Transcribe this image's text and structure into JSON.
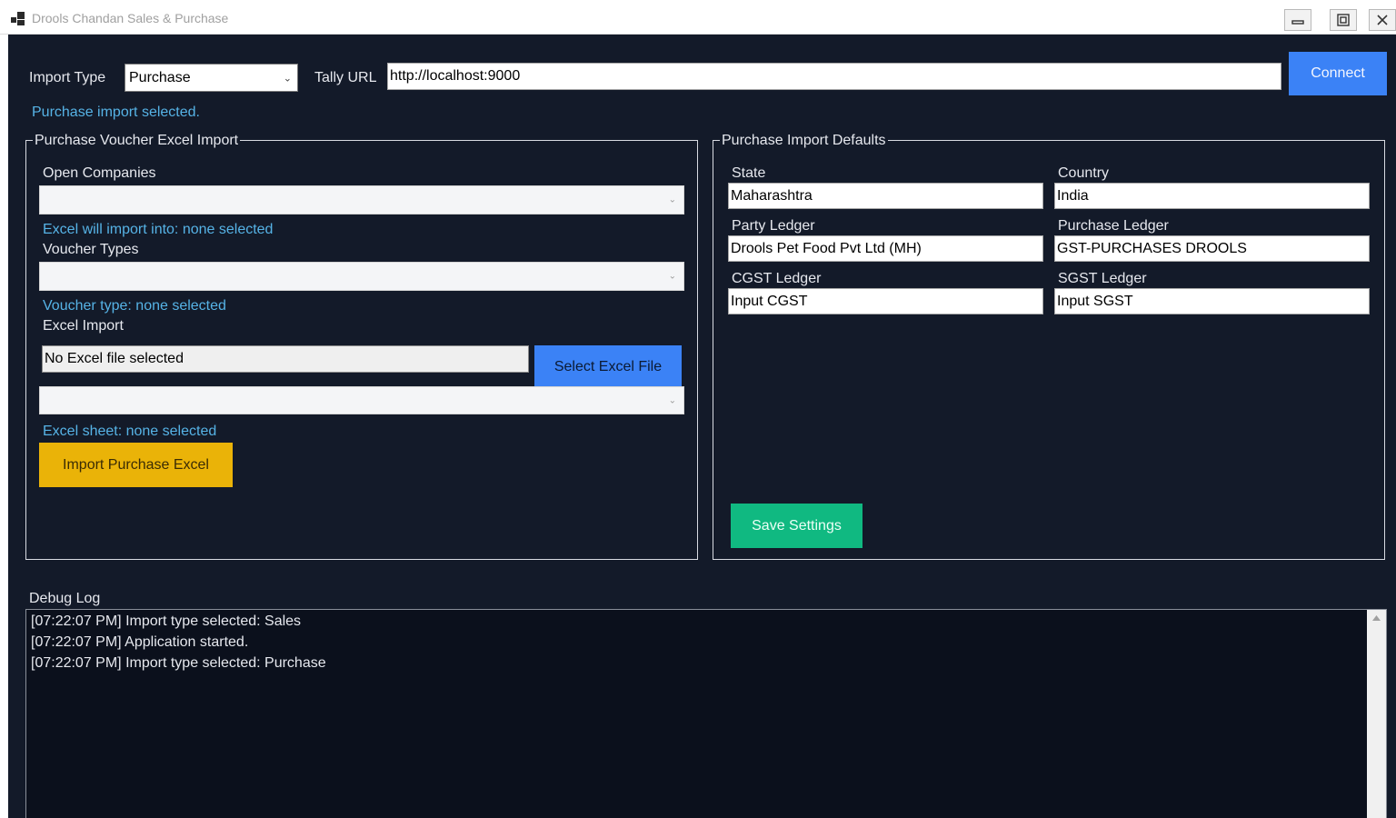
{
  "window": {
    "title": "Drools Chandan Sales & Purchase"
  },
  "topbar": {
    "import_type_label": "Import Type",
    "import_type_value": "Purchase",
    "tally_url_label": "Tally URL",
    "tally_url_value": "http://localhost:9000",
    "connect_label": "Connect",
    "status_text": "Purchase import selected."
  },
  "voucher_group": {
    "title": "Purchase Voucher  Excel Import",
    "open_companies_label": "Open Companies",
    "companies_info": "Excel will import into: none selected",
    "voucher_types_label": "Voucher Types",
    "voucher_info": "Voucher type: none selected",
    "excel_import_label": "Excel Import",
    "file_value": "No Excel file selected",
    "select_file_label": "Select Excel File",
    "sheet_info": "Excel sheet: none selected",
    "import_button_label": "Import Purchase Excel"
  },
  "defaults_group": {
    "title": "Purchase Import Defaults",
    "fields": [
      {
        "label": "State",
        "value": "Maharashtra"
      },
      {
        "label": "Country",
        "value": "India"
      },
      {
        "label": "Party Ledger",
        "value": "Drools Pet Food Pvt Ltd (MH)"
      },
      {
        "label": "Purchase Ledger",
        "value": "GST-PURCHASES DROOLS"
      },
      {
        "label": "CGST Ledger",
        "value": "Input CGST"
      },
      {
        "label": "SGST Ledger",
        "value": "Input SGST"
      }
    ],
    "save_label": "Save Settings"
  },
  "debug": {
    "label": "Debug Log",
    "lines": [
      "[07:22:07 PM] Import type selected: Sales",
      "[07:22:07 PM] Application started.",
      "[07:22:07 PM] Import type selected: Purchase"
    ]
  },
  "colors": {
    "background": "#131a29",
    "info_text": "#56b3e6",
    "connect_button": "#3b82f6",
    "import_button": "#eab308",
    "save_button": "#10b981"
  },
  "icons": {
    "app": "app-grid-icon",
    "minimize": "minimize-icon",
    "maximize": "restore-icon",
    "close": "close-icon",
    "dropdown": "chevron-down-icon",
    "scroll_up": "scroll-up-arrow-icon"
  }
}
